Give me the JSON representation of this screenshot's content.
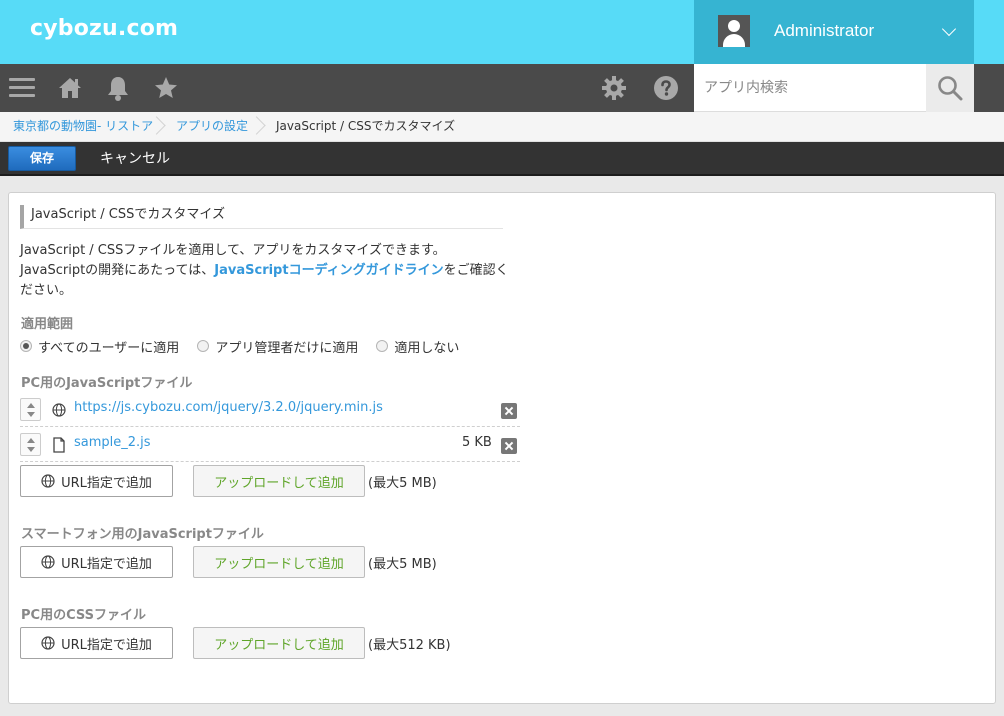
{
  "header": {
    "logo": "cybozu.com",
    "user_name": "Administrator"
  },
  "nav": {
    "search_placeholder": "アプリ内検索"
  },
  "breadcrumb": {
    "items": [
      "東京都の動物園- リストア",
      "アプリの設定",
      "JavaScript / CSSでカスタマイズ"
    ]
  },
  "actions": {
    "save_label": "保存",
    "cancel_label": "キャンセル"
  },
  "main": {
    "title": "JavaScript / CSSでカスタマイズ",
    "desc_line1": "JavaScript / CSSファイルを適用して、アプリをカスタマイズできます。",
    "desc_line2_prefix": "JavaScriptの開発にあたっては、",
    "desc_link": "JavaScriptコーディングガイドライン",
    "desc_line2_suffix": "をご確認ください。",
    "scope_label": "適用範囲",
    "scope_options": [
      "すべてのユーザーに適用",
      "アプリ管理者だけに適用",
      "適用しない"
    ],
    "scope_selected": "すべてのユーザーに適用",
    "pc_js_label": "PC用のJavaScriptファイル",
    "pc_js_files": [
      {
        "name": "https://js.cybozu.com/jquery/3.2.0/jquery.min.js",
        "size": "",
        "type": "url"
      },
      {
        "name": "sample_2.js",
        "size": "5 KB",
        "type": "file"
      }
    ],
    "sp_js_label": "スマートフォン用のJavaScriptファイル",
    "pc_css_label": "PC用のCSSファイル",
    "url_add_label": "URL指定で追加",
    "upload_add_label": "アップロードして追加",
    "limit_5mb": "(最大5 MB)",
    "limit_512kb": "(最大512 KB)"
  }
}
